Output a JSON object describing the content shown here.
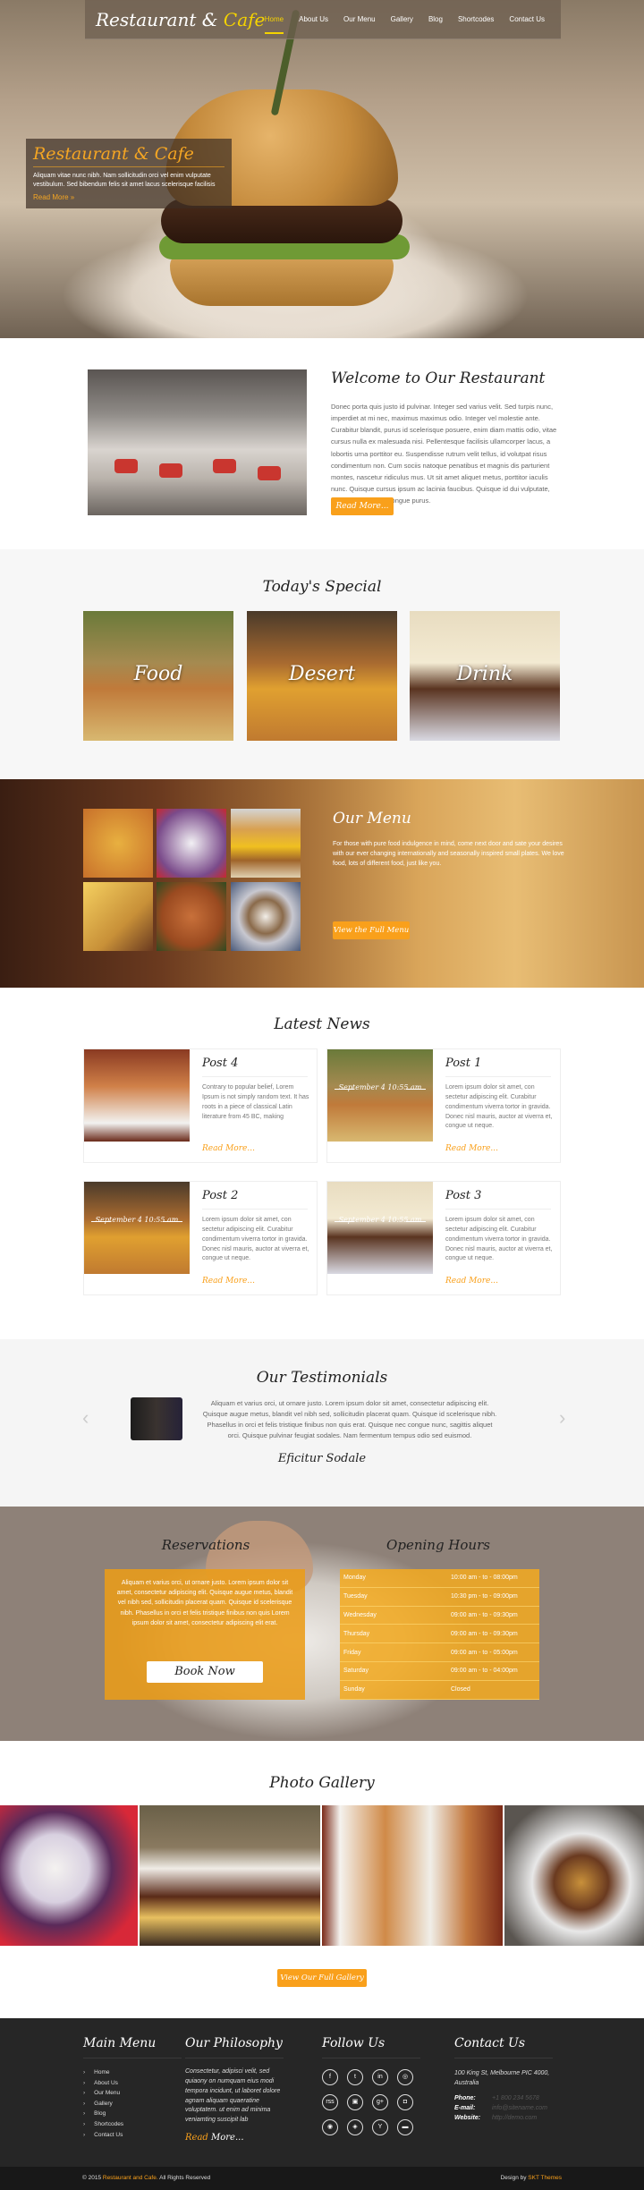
{
  "nav": {
    "logo_main": "Restaurant &",
    "logo_accent": "Cafe",
    "items": [
      "Home",
      "About Us",
      "Our Menu",
      "Gallery",
      "Blog",
      "Shortcodes",
      "Contact Us"
    ],
    "active": "Home"
  },
  "hero": {
    "caption_title": "Restaurant & Cafe",
    "caption_text": "Aliquam vitae nunc nibh. Nam sollicitudin orci vel enim vulputate vestibulum. Sed bibendum felis sit amet lacus scelerisque facilisis",
    "caption_link": "Read More »"
  },
  "welcome": {
    "title": "Welcome to Our Restaurant",
    "text": "Donec porta quis justo id pulvinar. Integer sed varius velit. Sed turpis nunc, imperdiet at mi nec, maximus maximus odio. Integer vel molestie ante. Curabitur blandit, purus id scelerisque posuere, enim diam mattis odio, vitae cursus nulla ex malesuada nisi. Pellentesque facilisis ullamcorper lacus, a lobortis urna porttitor eu. Suspendisse rutrum velit tellus, id volutpat risus condimentum non. Cum sociis natoque penatibus et magnis dis parturient montes, nascetur ridiculus mus. Ut sit amet aliquet metus, porttitor iaculis nunc. Quisque cursus ipsum ac lacinia faucibus. Quisque id dui vulputate, varius lectus vitae, congue purus.",
    "button": "Read More..."
  },
  "special": {
    "title": "Today's Special",
    "cards": [
      "Food",
      "Desert",
      "Drink"
    ]
  },
  "menu": {
    "title": "Our Menu",
    "text": "For those with pure food indulgence in mind, come next door and sate your desires with our ever changing internationally and seasonally inspired small plates. We love food, lots of different food, just like you.",
    "button": "View the Full Menu",
    "thumbs": [
      "pizza",
      "ice-cream",
      "burger",
      "fries",
      "fried-chicken",
      "coffee"
    ]
  },
  "news": {
    "title": "Latest News",
    "posts": [
      {
        "title": "Post 4",
        "date": "",
        "text": "Contrary to popular belief, Lorem Ipsum is not simply random text. It has roots in a piece of classical Latin literature from 45 BC, making",
        "more": "Read More..."
      },
      {
        "title": "Post 1",
        "date": "September 4 10:55 am",
        "text": "Lorem ipsum dolor sit amet, con sectetur adipiscing elit. Curabitur condimentum viverra tortor in gravida. Donec nisl mauris, auctor at viverra et, congue ut neque.",
        "more": "Read More..."
      },
      {
        "title": "Post 2",
        "date": "September 4 10:55 am",
        "text": "Lorem ipsum dolor sit amet, con sectetur adipiscing elit. Curabitur condimentum viverra tortor in gravida. Donec nisl mauris, auctor at viverra et, congue ut neque.",
        "more": "Read More..."
      },
      {
        "title": "Post 3",
        "date": "September 4 10:55 am",
        "text": "Lorem ipsum dolor sit amet, con sectetur adipiscing elit. Curabitur condimentum viverra tortor in gravida. Donec nisl mauris, auctor at viverra et, congue ut neque.",
        "more": "Read More..."
      }
    ]
  },
  "testimonials": {
    "title": "Our Testimonials",
    "text": "Aliquam et varius orci, ut ornare justo. Lorem ipsum dolor sit amet, consectetur adipiscing elit. Quisque augue metus, blandit vel nibh sed, sollicitudin placerat quam. Quisque id scelerisque nibh. Phasellus in orci et felis tristique finibus non quis erat. Quisque nec congue nunc, sagittis aliquet orci. Quisque pulvinar feugiat sodales. Nam fermentum tempus odio sed euismod.",
    "name": "Eficitur Sodale",
    "prev": "‹",
    "next": "›"
  },
  "reservations": {
    "title": "Reservations",
    "text": "Aliquam et varius orci, ut ornare justo. Lorem ipsum dolor sit amet, consectetur adipiscing elit. Quisque augue metus, blandit vel nibh sed, sollicitudin placerat quam. Quisque id scelerisque nibh. Phasellus in orci et felis tristique finibus non quis Lorem ipsum dolor sit amet, consectetur adipiscing elit erat.",
    "button": "Book Now"
  },
  "hours": {
    "title": "Opening Hours",
    "rows": [
      {
        "day": "Monday",
        "time": "10:00 am - to - 08:00pm"
      },
      {
        "day": "Tuesday",
        "time": "10:30 pm - to - 09:00pm"
      },
      {
        "day": "Wednesday",
        "time": "09:00 am - to - 09:30pm"
      },
      {
        "day": "Thursday",
        "time": "09:00 am - to - 09:30pm"
      },
      {
        "day": "Friday",
        "time": "09:00 am - to - 05:00pm"
      },
      {
        "day": "Saturday",
        "time": "09:00 am - to - 04:00pm"
      },
      {
        "day": "Sunday",
        "time": "Closed"
      }
    ]
  },
  "gallery": {
    "title": "Photo Gallery",
    "button": "View Our Full Gallery"
  },
  "footer": {
    "main_menu_title": "Main Menu",
    "main_menu": [
      "Home",
      "About Us",
      "Our Menu",
      "Gallery",
      "Blog",
      "Shortcodes",
      "Contact Us"
    ],
    "philosophy_title": "Our Philosophy",
    "philosophy_text": "Consectetur, adipisci velit, sed quiaony on numquam eius modi tempora incidunt, ut laboret dolore agnam aliquam quaeratine voluptatem. ut enim ad minima veniamting suscipit lab",
    "philosophy_more_1": "Read",
    "philosophy_more_2": "More...",
    "follow_title": "Follow Us",
    "social": [
      "f",
      "t",
      "in",
      "◎",
      "rss",
      "▣",
      "g+",
      "◘",
      "◉",
      "◈",
      "Y",
      "▬"
    ],
    "contact_title": "Contact Us",
    "address": "100 King St, Melbourne PIC 4000, Australia",
    "phone_label": "Phone:",
    "phone": "+1 800 234 5678",
    "email_label": "E-mail:",
    "email": "info@sitename.com",
    "website_label": "Website:",
    "website": "http://demo.com"
  },
  "bottom": {
    "copy_pre": "© 2015",
    "copy_brand": "Restaurant and Cafe.",
    "copy_post": "All Rights Reserved",
    "design_pre": "Design by",
    "design_brand": "SKT Themes"
  },
  "colors": {
    "accent": "#f9a01b",
    "logo_accent": "#f5d300",
    "footer": "#262626"
  }
}
